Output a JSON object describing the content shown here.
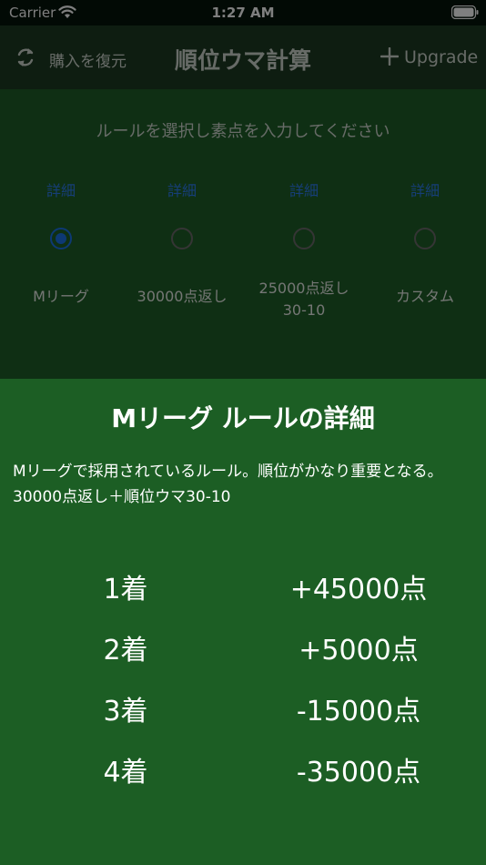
{
  "status_bar": {
    "carrier": "Carrier",
    "time": "1:27 AM"
  },
  "nav": {
    "restore_label": "購入を復元",
    "title": "順位ウマ計算",
    "upgrade_label": "Upgrade"
  },
  "instruction": "ルールを選択し素点を入力してください",
  "rules": [
    {
      "detail": "詳細",
      "label": "Mリーグ",
      "selected": true
    },
    {
      "detail": "詳細",
      "label": "30000点返し",
      "selected": false
    },
    {
      "detail": "詳細",
      "label": "25000点返し\n30-10",
      "selected": false
    },
    {
      "detail": "詳細",
      "label": "カスタム",
      "selected": false
    }
  ],
  "sheet": {
    "title": "Mリーグ ルールの詳細",
    "description": "Mリーグで採用されているルール。順位がかなり重要となる。30000点返し＋順位ウマ30-10",
    "placements": [
      {
        "place": "1着",
        "points": "+45000点"
      },
      {
        "place": "2着",
        "points": "+5000点"
      },
      {
        "place": "3着",
        "points": "-15000点"
      },
      {
        "place": "4着",
        "points": "-35000点"
      }
    ]
  },
  "colors": {
    "background": "#1c5e24",
    "accent": "#1a73e8",
    "link": "#2d7cf0"
  }
}
